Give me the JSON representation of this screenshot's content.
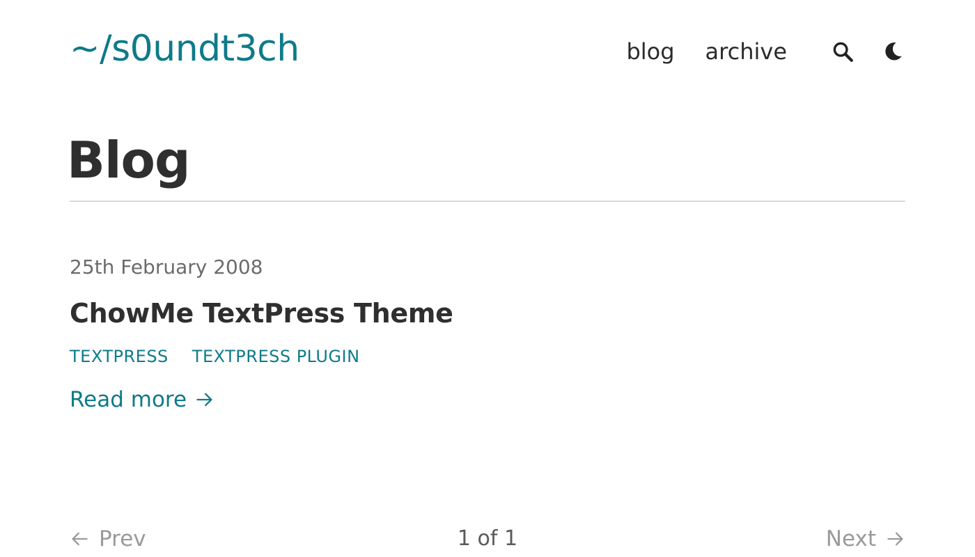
{
  "site": {
    "logo": "~/s0undt3ch"
  },
  "nav": {
    "items": [
      {
        "label": "blog"
      },
      {
        "label": "archive"
      }
    ],
    "icons": [
      "search-icon",
      "moon-icon"
    ]
  },
  "page": {
    "title": "Blog"
  },
  "posts": [
    {
      "date": "25th February 2008",
      "title": "ChowMe TextPress Theme",
      "tags": [
        "TEXTPRESS",
        "TEXTPRESS PLUGIN"
      ],
      "read_more": "Read more"
    }
  ],
  "pagination": {
    "prev": "Prev",
    "info": "1 of 1",
    "next": "Next"
  },
  "colors": {
    "accent": "#0f7a8a",
    "text": "#2f2f2f",
    "muted": "#9a9a9a",
    "divider": "#d9d9d9"
  }
}
